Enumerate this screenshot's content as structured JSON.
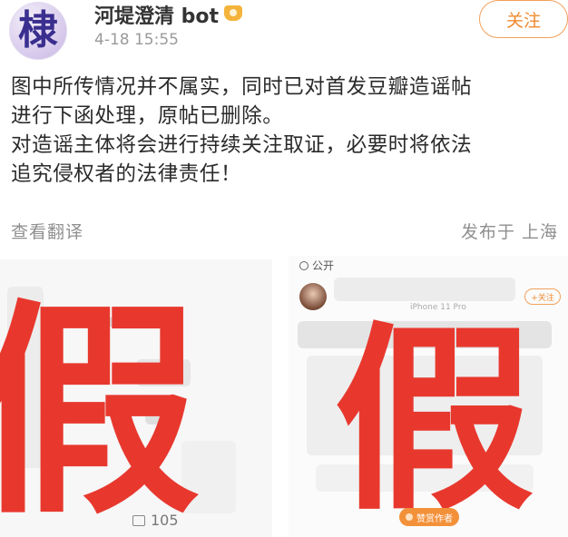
{
  "header": {
    "avatar_glyph": "棣",
    "username": "河堤澄清 bot",
    "timestamp": "4-18 15:55",
    "follow_label": "关注"
  },
  "post": {
    "lines": [
      "图中所传情况并不属实，同时已对首发豆瓣造谣帖",
      "进行下函处理，原帖已删除。",
      "对造谣主体将会进行持续关注取证，必要时将依法",
      "追究侵权者的法律责任！"
    ],
    "translate_label": "查看翻译",
    "location_label": "发布于 上海"
  },
  "images": {
    "left": {
      "stamp": "假",
      "comment_count": "105"
    },
    "right": {
      "stamp": "假",
      "public_label": "公开",
      "follow_label": "+关注",
      "device_label": "iPhone 11 Pro",
      "praise_label": "赞赏作者"
    }
  },
  "colors": {
    "follow_accent": "#f08a30",
    "stamp_red": "#e8382e"
  }
}
